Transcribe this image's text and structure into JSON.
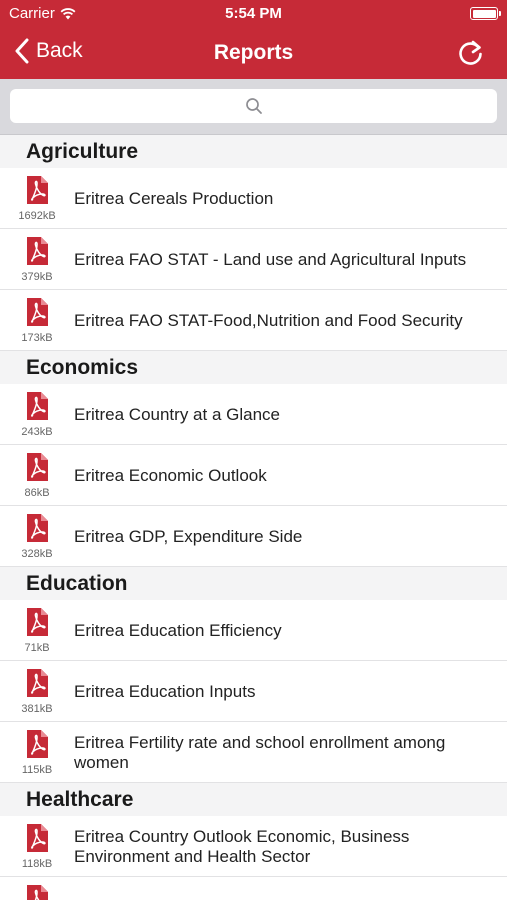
{
  "status_bar": {
    "carrier": "Carrier",
    "time": "5:54 PM"
  },
  "nav": {
    "back_label": "Back",
    "title": "Reports"
  },
  "search": {
    "placeholder": ""
  },
  "colors": {
    "brand": "#c62a37",
    "pdf_icon": "#c62a37"
  },
  "icons": {
    "pdf": "pdf-file-icon",
    "search": "search-icon",
    "refresh": "refresh-icon",
    "back": "chevron-left-icon"
  },
  "sections": [
    {
      "title": "Agriculture",
      "items": [
        {
          "label": "Eritrea Cereals Production",
          "size": "1692kB"
        },
        {
          "label": "Eritrea FAO STAT - Land use and Agricultural Inputs",
          "size": "379kB"
        },
        {
          "label": "Eritrea FAO STAT-Food,Nutrition and Food Security",
          "size": "173kB"
        }
      ]
    },
    {
      "title": "Economics",
      "items": [
        {
          "label": "Eritrea Country at a Glance",
          "size": "243kB"
        },
        {
          "label": "Eritrea Economic Outlook",
          "size": "86kB"
        },
        {
          "label": "Eritrea GDP, Expenditure Side",
          "size": "328kB"
        }
      ]
    },
    {
      "title": "Education",
      "items": [
        {
          "label": "Eritrea Education Efficiency",
          "size": "71kB"
        },
        {
          "label": "Eritrea Education Inputs",
          "size": "381kB"
        },
        {
          "label": "Eritrea Fertility rate and school enrollment among women",
          "size": "115kB"
        }
      ]
    },
    {
      "title": "Healthcare",
      "items": [
        {
          "label": "Eritrea Country Outlook Economic, Business Environment and Health Sector",
          "size": "118kB"
        },
        {
          "label": "",
          "size": ""
        }
      ]
    }
  ]
}
